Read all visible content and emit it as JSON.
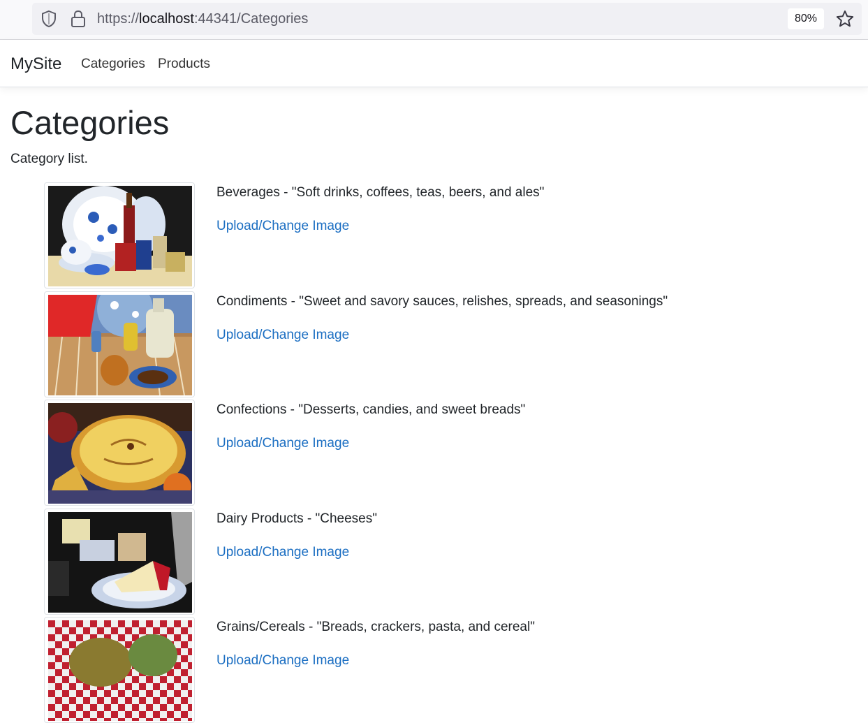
{
  "browser": {
    "url_scheme": "https://",
    "url_host": "localhost",
    "url_rest": ":44341/Categories",
    "zoom": "80%"
  },
  "navbar": {
    "brand": "MySite",
    "links": [
      "Categories",
      "Products"
    ]
  },
  "page": {
    "title": "Categories",
    "subtitle": "Category list."
  },
  "categories": [
    {
      "name": "Beverages",
      "separator": " - ",
      "description": "\"Soft drinks, coffees, teas, beers, and ales\"",
      "link": "Upload/Change Image"
    },
    {
      "name": "Condiments",
      "separator": " - ",
      "description": "\"Sweet and savory sauces, relishes, spreads, and seasonings\"",
      "link": "Upload/Change Image"
    },
    {
      "name": "Confections",
      "separator": " - ",
      "description": "\"Desserts, candies, and sweet breads\"",
      "link": "Upload/Change Image"
    },
    {
      "name": "Dairy Products",
      "separator": " - ",
      "description": "\"Cheeses\"",
      "link": "Upload/Change Image"
    },
    {
      "name": "Grains/Cereals",
      "separator": " - ",
      "description": "\"Breads, crackers, pasta, and cereal\"",
      "link": "Upload/Change Image"
    }
  ],
  "colors": {
    "link": "#1b6ec2",
    "text": "#212529"
  }
}
